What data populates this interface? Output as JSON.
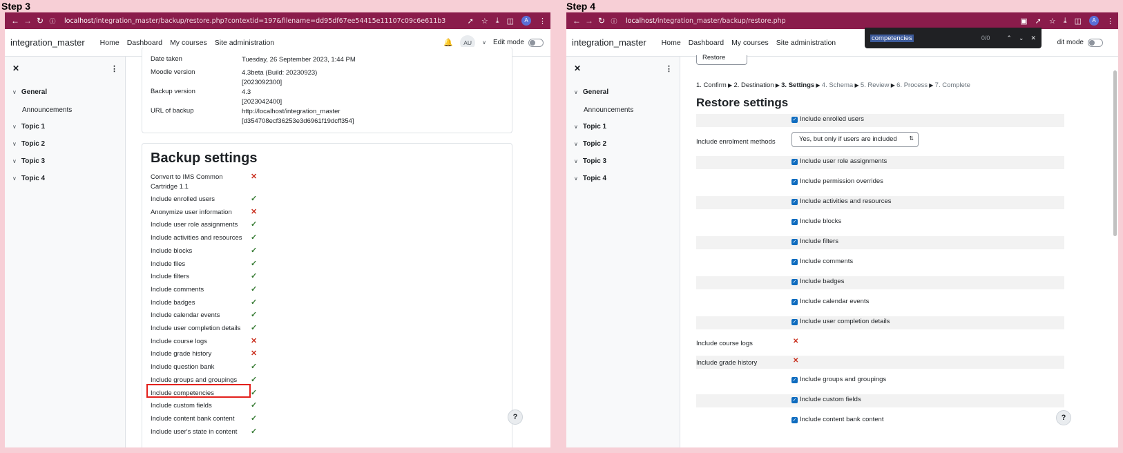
{
  "step3": {
    "label": "Step 3",
    "browser": {
      "url_host": "localhost",
      "url_path": "/integration_master/backup/restore.php?contextid=197&filename=dd95df67ee54415e11107c09c6e611b3",
      "account_initial": "A"
    },
    "nav": {
      "site_name": "integration_master",
      "links": [
        "Home",
        "Dashboard",
        "My courses",
        "Site administration"
      ],
      "avatar": "AU",
      "edit_mode": "Edit mode"
    },
    "sidebar": {
      "sections": [
        "General",
        "Topic 1",
        "Topic 2",
        "Topic 3",
        "Topic 4"
      ],
      "announcements": "Announcements"
    },
    "details": [
      {
        "label": "Date taken",
        "value": [
          "Tuesday, 26 September 2023, 1:44 PM"
        ]
      },
      {
        "label": "Moodle version",
        "value": [
          "4.3beta (Build: 20230923)",
          "[2023092300]"
        ]
      },
      {
        "label": "Backup version",
        "value": [
          "4.3",
          "[2023042400]"
        ]
      },
      {
        "label": "URL of backup",
        "value": [
          "http://localhost/integration_master",
          "[d354708ecf36253e3d6961f19dcff354]"
        ]
      }
    ],
    "backup_settings": {
      "title": "Backup settings",
      "items": [
        {
          "label": "Convert to IMS Common",
          "label2": "Cartridge 1.1",
          "ok": false
        },
        {
          "label": "Include enrolled users",
          "ok": true
        },
        {
          "label": "Anonymize user information",
          "ok": false
        },
        {
          "label": "Include user role assignments",
          "ok": true
        },
        {
          "label": "Include activities and resources",
          "ok": true
        },
        {
          "label": "Include blocks",
          "ok": true
        },
        {
          "label": "Include files",
          "ok": true
        },
        {
          "label": "Include filters",
          "ok": true
        },
        {
          "label": "Include comments",
          "ok": true
        },
        {
          "label": "Include badges",
          "ok": true
        },
        {
          "label": "Include calendar events",
          "ok": true
        },
        {
          "label": "Include user completion details",
          "ok": true
        },
        {
          "label": "Include course logs",
          "ok": false
        },
        {
          "label": "Include grade history",
          "ok": false
        },
        {
          "label": "Include question bank",
          "ok": true
        },
        {
          "label": "Include groups and groupings",
          "ok": true
        },
        {
          "label": "Include competencies",
          "ok": true
        },
        {
          "label": "Include custom fields",
          "ok": true
        },
        {
          "label": "Include content bank content",
          "ok": true
        },
        {
          "label": "Include user's state in content",
          "ok": true
        }
      ]
    },
    "help": "?"
  },
  "step4": {
    "label": "Step 4",
    "browser": {
      "url_host": "localhost",
      "url_path": "/integration_master/backup/restore.php",
      "account_initial": "A"
    },
    "find": {
      "query": "competencies",
      "count": "0/0"
    },
    "nav": {
      "site_name": "integration_master",
      "links": [
        "Home",
        "Dashboard",
        "My courses",
        "Site administration"
      ],
      "edit_mode": "dit mode"
    },
    "sidebar": {
      "sections": [
        "General",
        "Topic 1",
        "Topic 2",
        "Topic 3",
        "Topic 4"
      ],
      "announcements": "Announcements"
    },
    "restore_button": "Restore",
    "steps": [
      {
        "text": "1. Confirm",
        "state": "done"
      },
      {
        "text": "2. Destination",
        "state": "done"
      },
      {
        "text": "3. Settings",
        "state": "cur"
      },
      {
        "text": "4. Schema",
        "state": "todo"
      },
      {
        "text": "5. Review",
        "state": "todo"
      },
      {
        "text": "6. Process",
        "state": "todo"
      },
      {
        "text": "7. Complete",
        "state": "todo"
      }
    ],
    "restore_settings": {
      "title": "Restore settings",
      "enrolment_label": "Include enrolment methods",
      "enrolment_value": "Yes, but only if users are included",
      "options": [
        {
          "label": "Include enrolled users",
          "type": "check"
        },
        {
          "label": "Include enrolment methods",
          "type": "select"
        },
        {
          "label": "Include user role assignments",
          "type": "check"
        },
        {
          "label": "Include permission overrides",
          "type": "check"
        },
        {
          "label": "Include activities and resources",
          "type": "check"
        },
        {
          "label": "Include blocks",
          "type": "check"
        },
        {
          "label": "Include filters",
          "type": "check"
        },
        {
          "label": "Include comments",
          "type": "check"
        },
        {
          "label": "Include badges",
          "type": "check"
        },
        {
          "label": "Include calendar events",
          "type": "check"
        },
        {
          "label": "Include user completion details",
          "type": "check"
        },
        {
          "label": "Include course logs",
          "type": "cross"
        },
        {
          "label": "Include grade history",
          "type": "cross"
        },
        {
          "label": "Include groups and groupings",
          "type": "check"
        },
        {
          "label": "Include custom fields",
          "type": "check"
        },
        {
          "label": "Include content bank content",
          "type": "check"
        }
      ]
    },
    "help": "?"
  }
}
